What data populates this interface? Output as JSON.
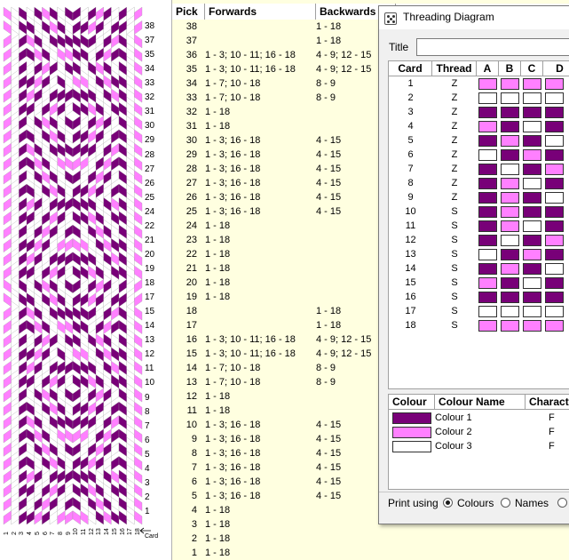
{
  "colors": {
    "colour1": "#780078",
    "colour2": "#ff80ff",
    "colour3": "#ffffff",
    "panel_bg": "#ffffe0",
    "pattern_bg": "#ffffff"
  },
  "pattern": {
    "card_count": 18,
    "visible_rows": [
      38,
      37,
      35,
      34,
      33,
      32,
      31,
      30,
      29,
      28,
      27,
      26,
      25,
      24,
      22,
      21,
      20,
      19,
      18,
      17,
      15,
      14,
      13,
      12,
      11,
      10,
      9,
      8,
      7,
      6,
      5,
      4,
      3,
      2,
      1
    ],
    "card_axis_label": "Card",
    "card_numbers": [
      "1",
      "2",
      "3",
      "4",
      "5",
      "6",
      "7",
      "8",
      "9",
      "10",
      "11",
      "12",
      "13",
      "14",
      "15",
      "16",
      "17",
      "18"
    ]
  },
  "pick_table": {
    "headers": {
      "pick": "Pick",
      "forwards": "Forwards",
      "backwards": "Backwards"
    },
    "rows": [
      {
        "pick": "38",
        "forwards": "",
        "backwards": "1 - 18"
      },
      {
        "pick": "37",
        "forwards": "",
        "backwards": "1 - 18"
      },
      {
        "pick": "36",
        "forwards": "1 - 3; 10 - 11; 16 - 18",
        "backwards": "4 - 9; 12 - 15"
      },
      {
        "pick": "35",
        "forwards": "1 - 3; 10 - 11; 16 - 18",
        "backwards": "4 - 9; 12 - 15"
      },
      {
        "pick": "34",
        "forwards": "1 - 7; 10 - 18",
        "backwards": "8 - 9"
      },
      {
        "pick": "33",
        "forwards": "1 - 7; 10 - 18",
        "backwards": "8 - 9"
      },
      {
        "pick": "32",
        "forwards": "1 - 18",
        "backwards": ""
      },
      {
        "pick": "31",
        "forwards": "1 - 18",
        "backwards": ""
      },
      {
        "pick": "30",
        "forwards": "1 - 3; 16 - 18",
        "backwards": "4 - 15"
      },
      {
        "pick": "29",
        "forwards": "1 - 3; 16 - 18",
        "backwards": "4 - 15"
      },
      {
        "pick": "28",
        "forwards": "1 - 3; 16 - 18",
        "backwards": "4 - 15"
      },
      {
        "pick": "27",
        "forwards": "1 - 3; 16 - 18",
        "backwards": "4 - 15"
      },
      {
        "pick": "26",
        "forwards": "1 - 3; 16 - 18",
        "backwards": "4 - 15"
      },
      {
        "pick": "25",
        "forwards": "1 - 3; 16 - 18",
        "backwards": "4 - 15"
      },
      {
        "pick": "24",
        "forwards": "1 - 18",
        "backwards": ""
      },
      {
        "pick": "23",
        "forwards": "1 - 18",
        "backwards": ""
      },
      {
        "pick": "22",
        "forwards": "1 - 18",
        "backwards": ""
      },
      {
        "pick": "21",
        "forwards": "1 - 18",
        "backwards": ""
      },
      {
        "pick": "20",
        "forwards": "1 - 18",
        "backwards": ""
      },
      {
        "pick": "19",
        "forwards": "1 - 18",
        "backwards": ""
      },
      {
        "pick": "18",
        "forwards": "",
        "backwards": "1 - 18"
      },
      {
        "pick": "17",
        "forwards": "",
        "backwards": "1 - 18"
      },
      {
        "pick": "16",
        "forwards": "1 - 3; 10 - 11; 16 - 18",
        "backwards": "4 - 9; 12 - 15"
      },
      {
        "pick": "15",
        "forwards": "1 - 3; 10 - 11; 16 - 18",
        "backwards": "4 - 9; 12 - 15"
      },
      {
        "pick": "14",
        "forwards": "1 - 7; 10 - 18",
        "backwards": "8 - 9"
      },
      {
        "pick": "13",
        "forwards": "1 - 7; 10 - 18",
        "backwards": "8 - 9"
      },
      {
        "pick": "12",
        "forwards": "1 - 18",
        "backwards": ""
      },
      {
        "pick": "11",
        "forwards": "1 - 18",
        "backwards": ""
      },
      {
        "pick": "10",
        "forwards": "1 - 3; 16 - 18",
        "backwards": "4 - 15"
      },
      {
        "pick": "9",
        "forwards": "1 - 3; 16 - 18",
        "backwards": "4 - 15"
      },
      {
        "pick": "8",
        "forwards": "1 - 3; 16 - 18",
        "backwards": "4 - 15"
      },
      {
        "pick": "7",
        "forwards": "1 - 3; 16 - 18",
        "backwards": "4 - 15"
      },
      {
        "pick": "6",
        "forwards": "1 - 3; 16 - 18",
        "backwards": "4 - 15"
      },
      {
        "pick": "5",
        "forwards": "1 - 3; 16 - 18",
        "backwards": "4 - 15"
      },
      {
        "pick": "4",
        "forwards": "1 - 18",
        "backwards": ""
      },
      {
        "pick": "3",
        "forwards": "1 - 18",
        "backwards": ""
      },
      {
        "pick": "2",
        "forwards": "1 - 18",
        "backwards": ""
      },
      {
        "pick": "1",
        "forwards": "1 - 18",
        "backwards": ""
      }
    ]
  },
  "threading_dialog": {
    "window_title": "Threading Diagram",
    "title_label": "Title",
    "title_value": "",
    "grid_headers": {
      "card": "Card",
      "thread": "Thread",
      "a": "A",
      "b": "B",
      "c": "C",
      "d": "D"
    },
    "cards": [
      {
        "card": "1",
        "thread": "Z",
        "holes": [
          2,
          2,
          2,
          2
        ]
      },
      {
        "card": "2",
        "thread": "Z",
        "holes": [
          3,
          3,
          3,
          3
        ]
      },
      {
        "card": "3",
        "thread": "Z",
        "holes": [
          1,
          1,
          1,
          1
        ]
      },
      {
        "card": "4",
        "thread": "Z",
        "holes": [
          2,
          1,
          3,
          1
        ]
      },
      {
        "card": "5",
        "thread": "Z",
        "holes": [
          1,
          2,
          1,
          3
        ]
      },
      {
        "card": "6",
        "thread": "Z",
        "holes": [
          3,
          1,
          2,
          1
        ]
      },
      {
        "card": "7",
        "thread": "Z",
        "holes": [
          1,
          3,
          1,
          2
        ]
      },
      {
        "card": "8",
        "thread": "Z",
        "holes": [
          1,
          2,
          3,
          1
        ]
      },
      {
        "card": "9",
        "thread": "Z",
        "holes": [
          1,
          2,
          1,
          3
        ]
      },
      {
        "card": "10",
        "thread": "S",
        "holes": [
          1,
          2,
          1,
          1
        ]
      },
      {
        "card": "11",
        "thread": "S",
        "holes": [
          1,
          2,
          3,
          1
        ]
      },
      {
        "card": "12",
        "thread": "S",
        "holes": [
          1,
          3,
          1,
          2
        ]
      },
      {
        "card": "13",
        "thread": "S",
        "holes": [
          3,
          1,
          2,
          1
        ]
      },
      {
        "card": "14",
        "thread": "S",
        "holes": [
          1,
          2,
          1,
          3
        ]
      },
      {
        "card": "15",
        "thread": "S",
        "holes": [
          2,
          1,
          3,
          1
        ]
      },
      {
        "card": "16",
        "thread": "S",
        "holes": [
          1,
          1,
          1,
          1
        ]
      },
      {
        "card": "17",
        "thread": "S",
        "holes": [
          3,
          3,
          3,
          3
        ]
      },
      {
        "card": "18",
        "thread": "S",
        "holes": [
          2,
          2,
          2,
          2
        ]
      }
    ],
    "colour_headers": {
      "colour": "Colour",
      "colour_name": "Colour Name",
      "character": "Character"
    },
    "colours": [
      {
        "name": "Colour 1",
        "character": "F",
        "color": "#780078"
      },
      {
        "name": "Colour 2",
        "character": "F",
        "color": "#ff80ff"
      },
      {
        "name": "Colour 3",
        "character": "F",
        "color": "#ffffff"
      }
    ],
    "print_using_label": "Print using",
    "print_options": [
      {
        "label": "Colours",
        "checked": true
      },
      {
        "label": "Names",
        "checked": false
      },
      {
        "label": "",
        "checked": false
      }
    ]
  }
}
